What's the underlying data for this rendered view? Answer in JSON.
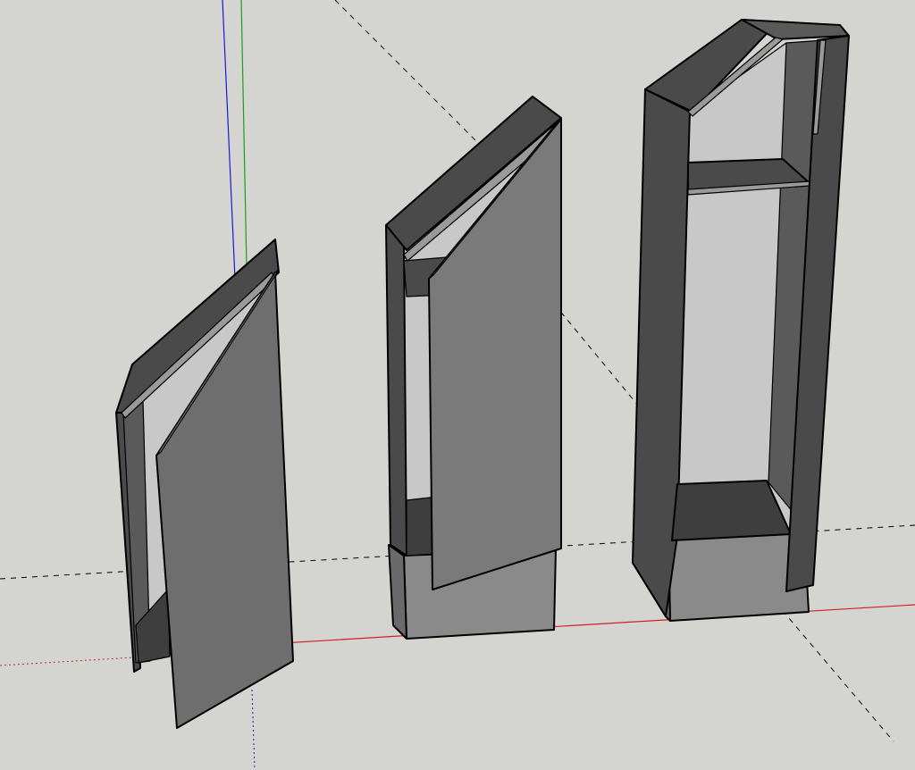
{
  "model_view": {
    "background_color": "#d4d4d0",
    "axes": {
      "red_axis_color": "#d02020",
      "green_axis_color": "#18a018",
      "blue_axis_color": "#1a1ad8",
      "dashed_guide_color": "#000000"
    },
    "material_colors": {
      "dark_face": "#4a4a4a",
      "mid_face": "#6e6e6e",
      "light_face": "#8a8a8a",
      "interior_face": "#c8c8c8",
      "edge_highlight": "#9a9a9a"
    },
    "objects": [
      {
        "name": "cabinet-left",
        "state": "door-open"
      },
      {
        "name": "cabinet-middle",
        "state": "door-open"
      },
      {
        "name": "cabinet-right",
        "state": "no-door"
      }
    ]
  }
}
